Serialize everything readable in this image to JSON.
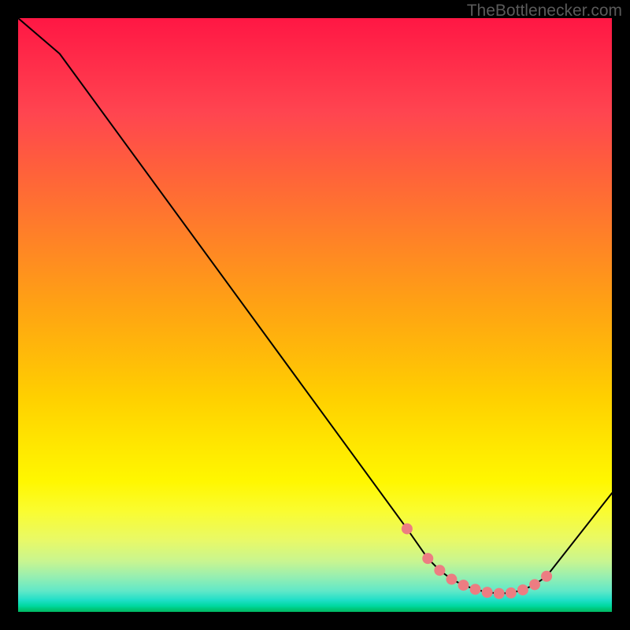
{
  "watermark": "TheBottlenecker.com",
  "chart_data": {
    "type": "line",
    "title": "",
    "xlabel": "",
    "ylabel": "",
    "xlim": [
      0,
      100
    ],
    "ylim": [
      0,
      100
    ],
    "series": [
      {
        "name": "curve",
        "x": [
          0,
          7,
          65.5,
          69,
          71,
          73,
          75,
          77,
          79,
          81,
          83,
          85,
          87,
          89,
          100
        ],
        "values": [
          100,
          94,
          14,
          9,
          7,
          5.5,
          4.5,
          3.8,
          3.3,
          3.1,
          3.2,
          3.7,
          4.6,
          6,
          20
        ]
      }
    ],
    "markers": {
      "x": [
        65.5,
        69,
        71,
        73,
        75,
        77,
        79,
        81,
        83,
        85,
        87,
        89
      ],
      "values": [
        14,
        9,
        7,
        5.5,
        4.5,
        3.8,
        3.3,
        3.1,
        3.2,
        3.7,
        4.6,
        6
      ],
      "color": "#ec7d82",
      "radius": 7
    },
    "background_gradient": {
      "top": "#ff1744",
      "mid": "#ffe700",
      "bottom": "#00b863"
    },
    "line_color": "#000000",
    "line_width": 2
  }
}
